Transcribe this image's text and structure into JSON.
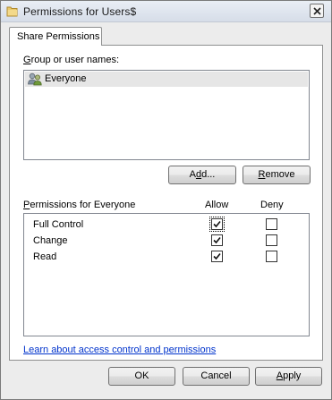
{
  "window": {
    "title": "Permissions for Users$"
  },
  "tab": {
    "label": "Share Permissions"
  },
  "group_section": {
    "label_underline": "G",
    "label_rest": "roup or user names:",
    "items": [
      {
        "label": "Everyone",
        "icon": "users-icon",
        "selected": true
      }
    ]
  },
  "buttons": {
    "add": {
      "pre": "A",
      "underline": "d",
      "post": "d..."
    },
    "remove": {
      "underline": "R",
      "post": "emove"
    },
    "ok": "OK",
    "cancel": "Cancel",
    "apply": {
      "underline": "A",
      "post": "pply"
    }
  },
  "permissions": {
    "label_underline": "P",
    "label_rest": "ermissions for Everyone",
    "allow_header": "Allow",
    "deny_header": "Deny",
    "rows": [
      {
        "name": "Full Control",
        "allow": true,
        "deny": false
      },
      {
        "name": "Change",
        "allow": true,
        "deny": false
      },
      {
        "name": "Read",
        "allow": true,
        "deny": false
      }
    ]
  },
  "learn_link": "Learn about access control and permissions",
  "colors": {
    "link": "#0033cc",
    "selection": "#e6e6e6"
  }
}
